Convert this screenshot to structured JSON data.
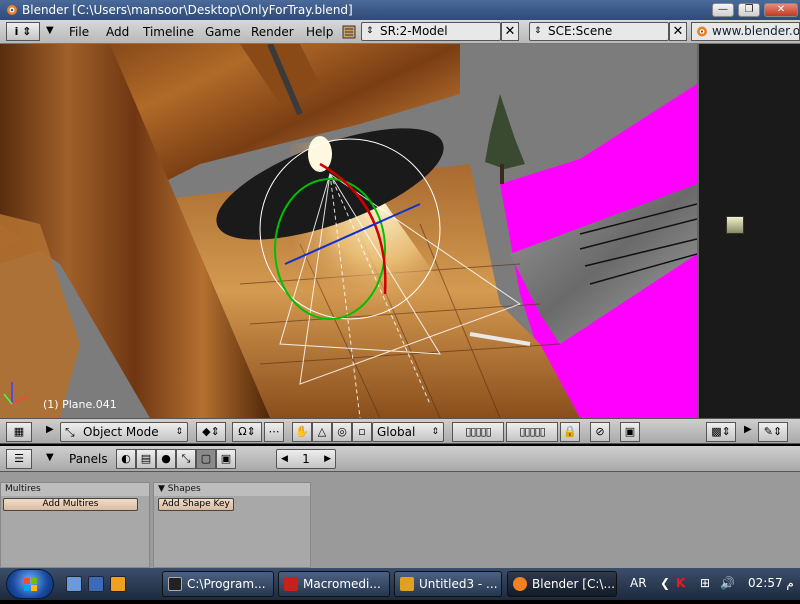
{
  "window": {
    "title": "Blender [C:\\Users\\mansoor\\Desktop\\OnlyForTray.blend]",
    "min_glyph": "—",
    "max_glyph": "❐",
    "close_glyph": "✕"
  },
  "menu": {
    "items": [
      "File",
      "Add",
      "Timeline",
      "Game",
      "Render",
      "Help"
    ]
  },
  "header": {
    "screen_field": "SR:2-Model",
    "scene_field": "SCE:Scene",
    "url": "www.blender.org"
  },
  "viewport": {
    "object_label": "(1) Plane.041"
  },
  "viewport_toolbar": {
    "mode": "Object Mode",
    "orientation": "Global"
  },
  "buttons_header": {
    "panels_label": "Panels",
    "frame_value": "1"
  },
  "panels": [
    {
      "title": "Multires",
      "button": "Add Multires"
    },
    {
      "title": "Shapes",
      "button": "Add Shape Key"
    }
  ],
  "taskbar": {
    "tasks": [
      {
        "label": "C:\\Program...",
        "icon": "cmd-icon",
        "color": "#222222"
      },
      {
        "label": "Macromedi...",
        "icon": "flash-icon",
        "color": "#c8201a"
      },
      {
        "label": "Untitled3 - ...",
        "icon": "notepad-icon",
        "color": "#e0a020"
      },
      {
        "label": "Blender [C:\\...",
        "icon": "blender-icon",
        "color": "#f08020"
      }
    ],
    "lang": "AR",
    "time": "02:57 م"
  },
  "colors": {
    "magenta": "#ff00ff",
    "wood": "#8a4a1a"
  }
}
